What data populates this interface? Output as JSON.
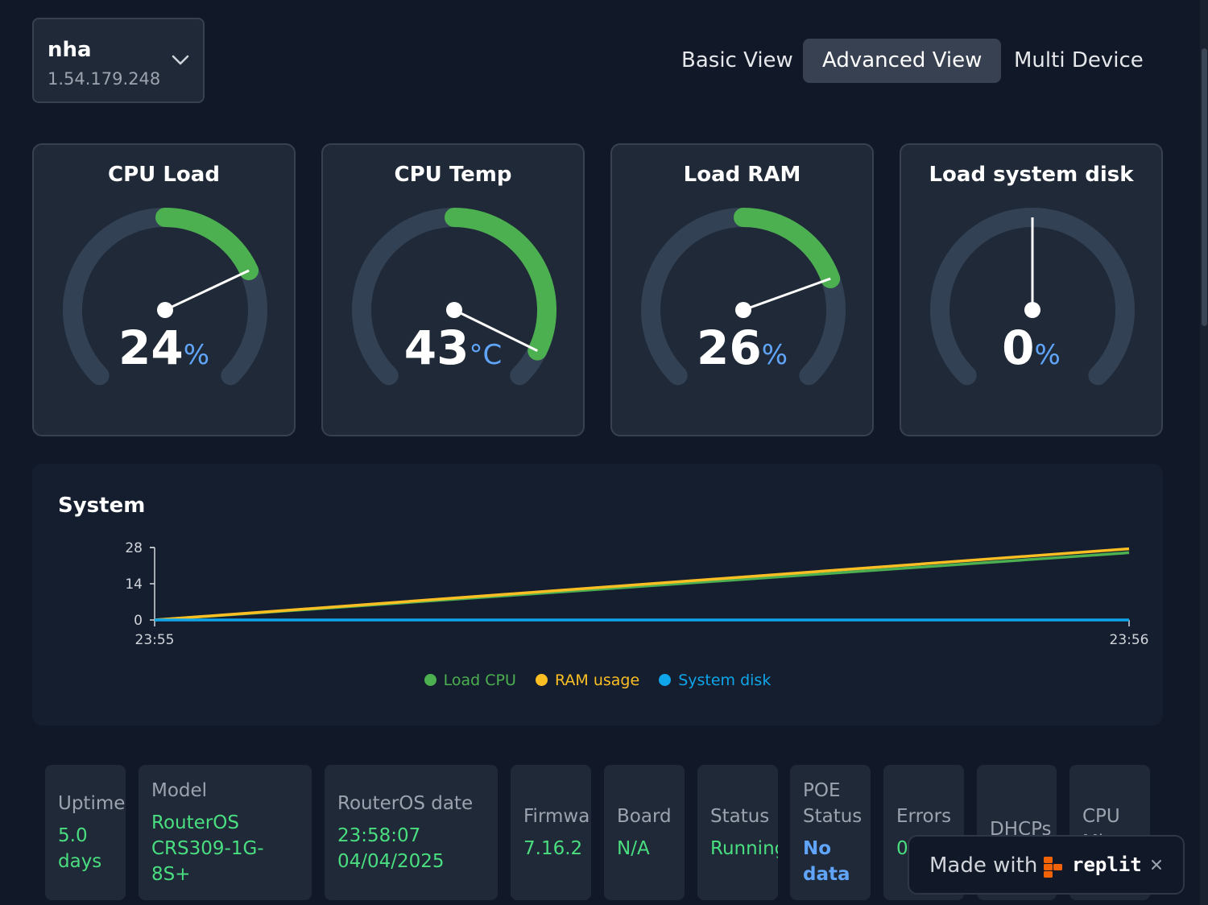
{
  "device_selector": {
    "name": "nha",
    "ip": "1.54.179.248",
    "icon": "chevron-down-icon"
  },
  "view_tabs": [
    {
      "label": "Basic View",
      "active": false
    },
    {
      "label": "Advanced View",
      "active": true
    },
    {
      "label": "Multi Device",
      "active": false
    }
  ],
  "gauges": [
    {
      "title": "CPU Load",
      "value": "24",
      "unit": "%",
      "level": 0.24
    },
    {
      "title": "CPU Temp",
      "value": "43",
      "unit": "°C",
      "level": 0.43
    },
    {
      "title": "Load RAM",
      "value": "26",
      "unit": "%",
      "level": 0.26
    },
    {
      "title": "Load system disk",
      "value": "0",
      "unit": "%",
      "level": 0.0
    }
  ],
  "colors": {
    "gauge_fill": "#4caf50",
    "gauge_track": "#334155",
    "load_cpu": "#4caf50",
    "ram_usage": "#fbbf24",
    "system_disk": "#0ea5e9",
    "value_green": "#4ade80",
    "value_blue": "#60a5fa"
  },
  "system_panel": {
    "title": "System"
  },
  "chart_data": {
    "type": "line",
    "title": "",
    "x": [
      "23:55",
      "23:56"
    ],
    "y_ticks": [
      "0",
      "14",
      "28"
    ],
    "ylim": [
      0,
      28
    ],
    "series": [
      {
        "name": "Load CPU",
        "values": [
          0,
          26
        ],
        "color": "#4caf50"
      },
      {
        "name": "RAM usage",
        "values": [
          0,
          27.5
        ],
        "color": "#fbbf24"
      },
      {
        "name": "System disk",
        "values": [
          0,
          0
        ],
        "color": "#0ea5e9"
      }
    ],
    "legend_position": "bottom-center",
    "grid": false
  },
  "info_cards": [
    {
      "label": "Uptime",
      "value": "5.0\ndays"
    },
    {
      "label": "Model",
      "value": "RouterOS\nCRS309-1G-8S+"
    },
    {
      "label": "RouterOS date",
      "value": "23:58:07\n04/04/2025"
    },
    {
      "label": "Firmware",
      "value": "7.16.2"
    },
    {
      "label": "Board",
      "value": "N/A"
    },
    {
      "label": "Status",
      "value": "Running"
    },
    {
      "label": "POE\nStatus",
      "value": "No\ndata"
    },
    {
      "label": "Errors",
      "value": "0"
    },
    {
      "label": "DHCPs",
      "value": ""
    },
    {
      "label": "CPU\nMhz",
      "value": ""
    }
  ],
  "replit_badge": {
    "made_with": "Made with",
    "brand": "replit",
    "close_icon": "close-icon"
  }
}
